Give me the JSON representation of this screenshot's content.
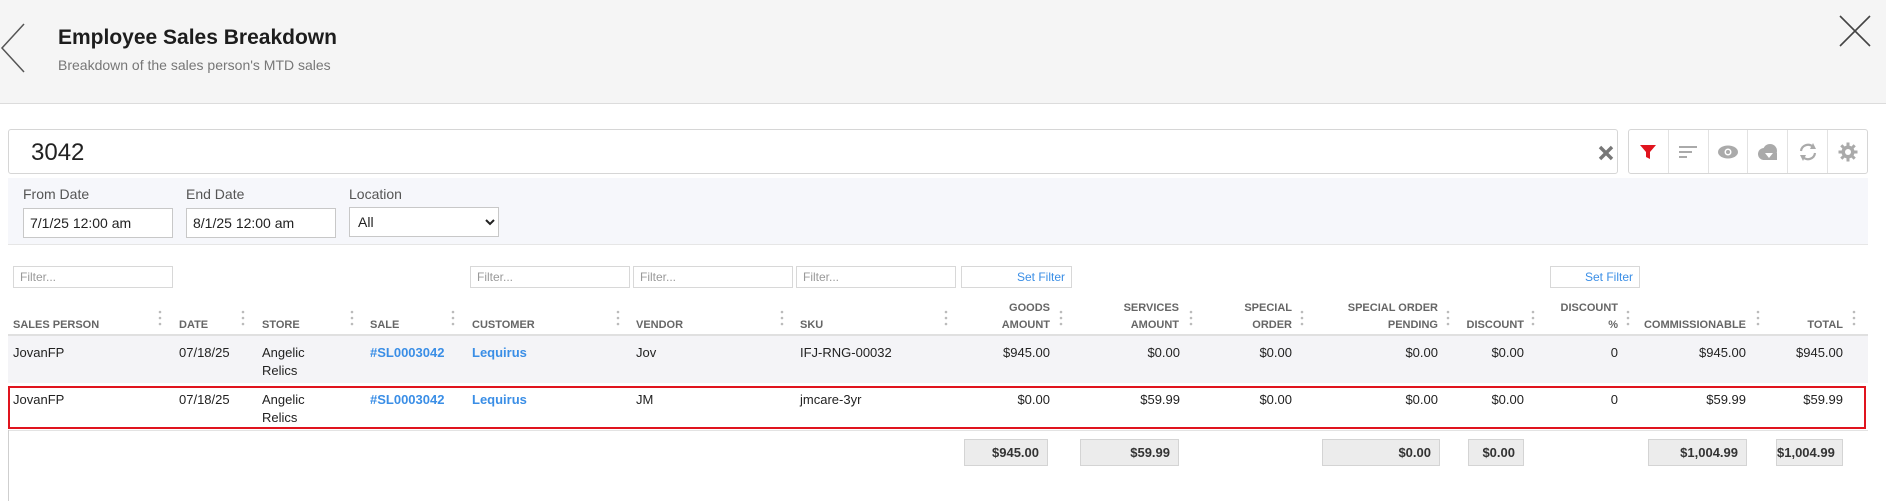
{
  "header": {
    "title": "Employee Sales Breakdown",
    "subtitle": "Breakdown of the sales person's MTD sales"
  },
  "search": {
    "value": "3042"
  },
  "toolbar": {
    "icons": [
      "filter-icon",
      "sort-icon",
      "eye-icon",
      "cloud-download-icon",
      "refresh-icon",
      "gear-icon"
    ],
    "active_color": "#e0141e"
  },
  "filters": {
    "from_label": "From Date",
    "from_value": "7/1/25 12:00 am",
    "end_label": "End Date",
    "end_value": "8/1/25 12:00 am",
    "location_label": "Location",
    "location_value": "All"
  },
  "column_filters": {
    "placeholder": "Filter...",
    "set_filter": "Set Filter"
  },
  "table": {
    "headers": {
      "sales_person": "SALES PERSON",
      "date": "DATE",
      "store": "STORE",
      "sale": "SALE",
      "customer": "CUSTOMER",
      "vendor": "VENDOR",
      "sku": "SKU",
      "goods_amount_1": "GOODS",
      "goods_amount_2": "AMOUNT",
      "services_amount_1": "SERVICES",
      "services_amount_2": "AMOUNT",
      "special_order_1": "SPECIAL",
      "special_order_2": "ORDER",
      "special_order_pending_1": "SPECIAL ORDER",
      "special_order_pending_2": "PENDING",
      "discount": "DISCOUNT",
      "discount_pct_1": "DISCOUNT",
      "discount_pct_2": "%",
      "commissionable": "COMMISSIONABLE",
      "total": "TOTAL"
    },
    "rows": [
      {
        "sales_person": "JovanFP",
        "date": "07/18/25",
        "store_1": "Angelic",
        "store_2": "Relics",
        "sale": "#SL0003042",
        "customer": "Lequirus",
        "vendor": "Jov",
        "sku": "IFJ-RNG-00032",
        "goods_amount": "$945.00",
        "services_amount": "$0.00",
        "special_order": "$0.00",
        "special_order_pending": "$0.00",
        "discount": "$0.00",
        "discount_pct": "0",
        "commissionable": "$945.00",
        "total": "$945.00"
      },
      {
        "sales_person": "JovanFP",
        "date": "07/18/25",
        "store_1": "Angelic",
        "store_2": "Relics",
        "sale": "#SL0003042",
        "customer": "Lequirus",
        "vendor": "JM",
        "sku": "jmcare-3yr",
        "goods_amount": "$0.00",
        "services_amount": "$59.99",
        "special_order": "$0.00",
        "special_order_pending": "$0.00",
        "discount": "$0.00",
        "discount_pct": "0",
        "commissionable": "$59.99",
        "total": "$59.99"
      }
    ],
    "totals": {
      "goods_amount": "$945.00",
      "services_amount": "$59.99",
      "special_order_pending": "$0.00",
      "discount": "$0.00",
      "commissionable": "$1,004.99",
      "total": "$1,004.99"
    }
  },
  "colors": {
    "link": "#3a8ee6",
    "highlight": "#e0141e",
    "header_bg": "#f5f5f5"
  }
}
